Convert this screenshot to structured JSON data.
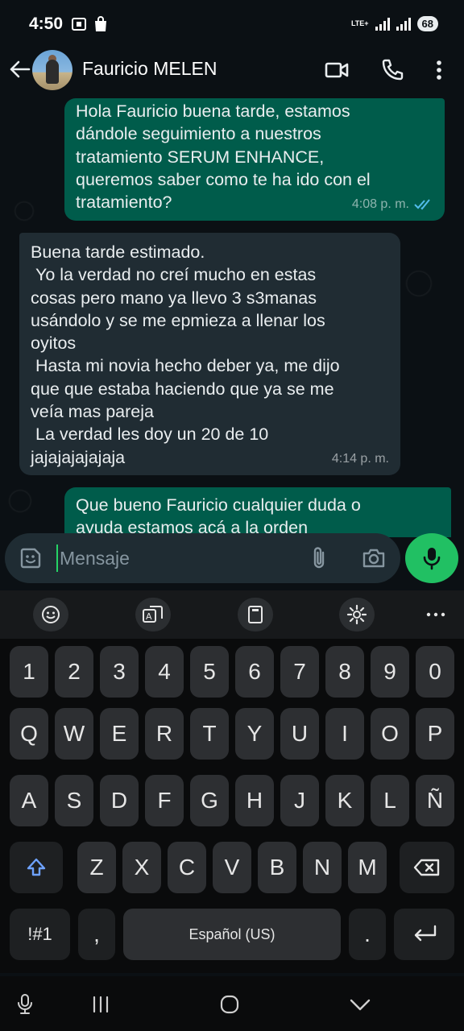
{
  "status": {
    "time": "4:50",
    "network": "LTE+",
    "battery": "68"
  },
  "header": {
    "contact_name": "Fauricio MELEN"
  },
  "messages": [
    {
      "direction": "out",
      "text": "Hola Fauricio buena tarde, estamos\ndándole seguimiento a nuestros\ntratamiento SERUM ENHANCE,\nqueremos saber como te ha ido con el\ntratamiento?",
      "time": "4:08 p. m.",
      "read": true
    },
    {
      "direction": "in",
      "text": "Buena tarde estimado.\n Yo la verdad no creí mucho en estas\ncosas pero mano ya llevo 3 s3manas\nusándolo y se me epmieza a llenar los\noyitos\n Hasta mi novia hecho deber ya, me dijo\nque que estaba haciendo que ya se me\nveía mas pareja\n La verdad les doy un 20 de 10\njajajajajajaja",
      "time": "4:14 p. m."
    },
    {
      "direction": "out",
      "text": "Que bueno Fauricio cualquier duda o\nayuda estamos acá a la orden",
      "time": ""
    }
  ],
  "composer": {
    "placeholder": "Mensaje"
  },
  "keyboard": {
    "row_numbers": [
      "1",
      "2",
      "3",
      "4",
      "5",
      "6",
      "7",
      "8",
      "9",
      "0"
    ],
    "row_top": [
      "Q",
      "W",
      "E",
      "R",
      "T",
      "Y",
      "U",
      "I",
      "O",
      "P"
    ],
    "row_home": [
      "A",
      "S",
      "D",
      "F",
      "G",
      "H",
      "J",
      "K",
      "L",
      "Ñ"
    ],
    "row_bottom": [
      "Z",
      "X",
      "C",
      "V",
      "B",
      "N",
      "M"
    ],
    "symbols_label": "!#1",
    "comma_label": ",",
    "space_label": "Español (US)",
    "period_label": "."
  },
  "colors": {
    "outgoing_bubble": "#005c4b",
    "incoming_bubble": "#202c33",
    "accent": "#21c063",
    "read_ticks": "#53bdeb"
  }
}
